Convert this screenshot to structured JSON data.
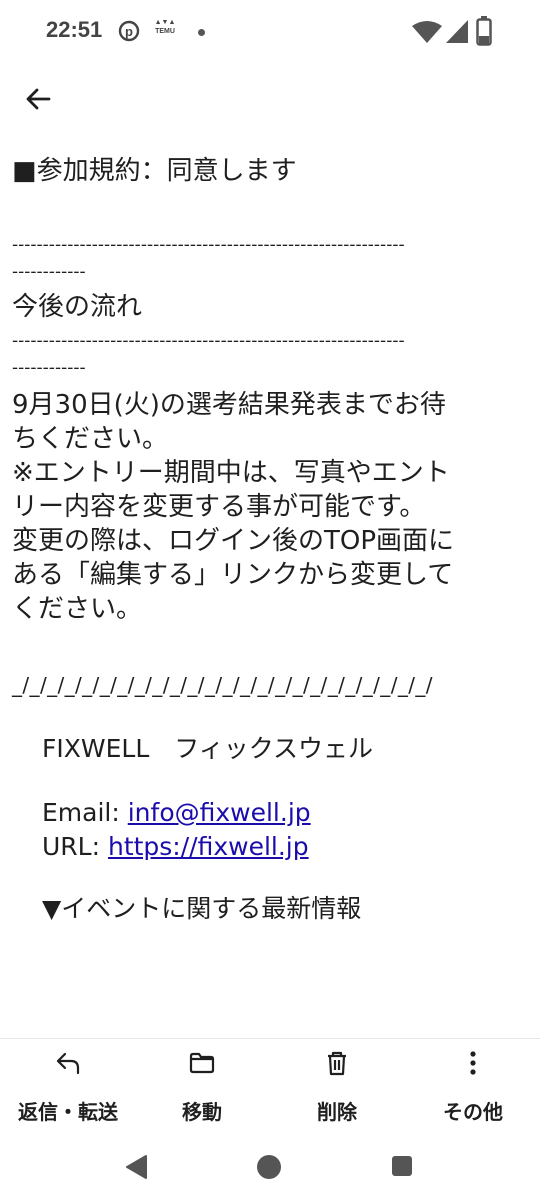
{
  "status": {
    "time": "22:51",
    "temu_logo": "TEMU"
  },
  "email": {
    "lines": [
      "■参加規約：同意します",
      "",
      "----------------------------------------------------------------",
      "------------",
      "今後の流れ",
      "----------------------------------------------------------------",
      "------------",
      "9月30日(火)の選考結果発表までお待",
      "ちください。",
      "※エントリー期間中は、写真やエント",
      "リー内容を変更する事が可能です。",
      "変更の際は、ログイン後のTOP画面に",
      "ある「編集する」リンクから変更して",
      "ください。",
      "",
      "_/_/_/_/_/_/_/_/_/_/_/_/_/_/_/_/_/_/_/_/_/_/_/_/"
    ],
    "company": "FIXWELL　フィックスウェル",
    "email_label": "Email: ",
    "email_value": "info@fixwell.jp",
    "url_label": "URL: ",
    "url_value": "https://fixwell.jp",
    "next_heading": "▼イベントに関する最新情報"
  },
  "actions": {
    "reply": "返信・転送",
    "move": "移動",
    "delete": "削除",
    "more": "その他"
  }
}
